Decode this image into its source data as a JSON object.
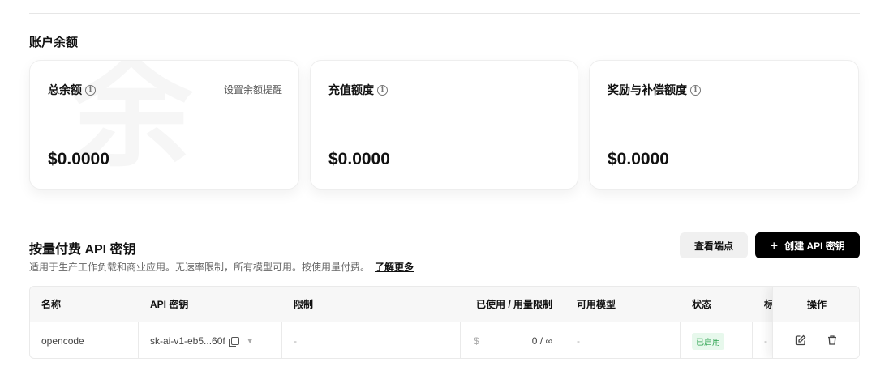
{
  "balance": {
    "section_title": "账户余额",
    "watermark": "余",
    "cards": [
      {
        "label": "总余额",
        "amount": "$0.0000",
        "link": "设置余额提醒"
      },
      {
        "label": "充值额度",
        "amount": "$0.0000"
      },
      {
        "label": "奖励与补偿额度",
        "amount": "$0.0000"
      }
    ],
    "info_icon_glyph": "i"
  },
  "api_keys": {
    "title": "按量付费 API 密钥",
    "description": "适用于生产工作负载和商业应用。无速率限制，所有模型可用。按使用量付费。",
    "learn_more": "了解更多",
    "view_endpoints_label": "查看端点",
    "create_label": "创建 API 密钥",
    "table": {
      "headers": {
        "name": "名称",
        "key": "API 密钥",
        "limit": "限制",
        "usage": "已使用 / 用量限制",
        "models": "可用模型",
        "status": "状态",
        "tags": "标",
        "actions": "操作"
      },
      "rows": [
        {
          "name": "opencode",
          "key": "sk-ai-v1-eb5...60f",
          "limit": "-",
          "currency": "$",
          "usage": "0 / ∞",
          "models": "-",
          "status": "已启用",
          "tags": "-"
        }
      ]
    }
  },
  "icons": {
    "copy": "copy-icon",
    "dropdown": "chevron-down-icon",
    "edit": "edit-icon",
    "delete": "trash-icon",
    "plus": "plus-icon",
    "info": "info-icon"
  },
  "colors": {
    "status_badge_bg": "#e7f8ec",
    "status_badge_text": "#2ca24f",
    "primary_button": "#000000"
  }
}
